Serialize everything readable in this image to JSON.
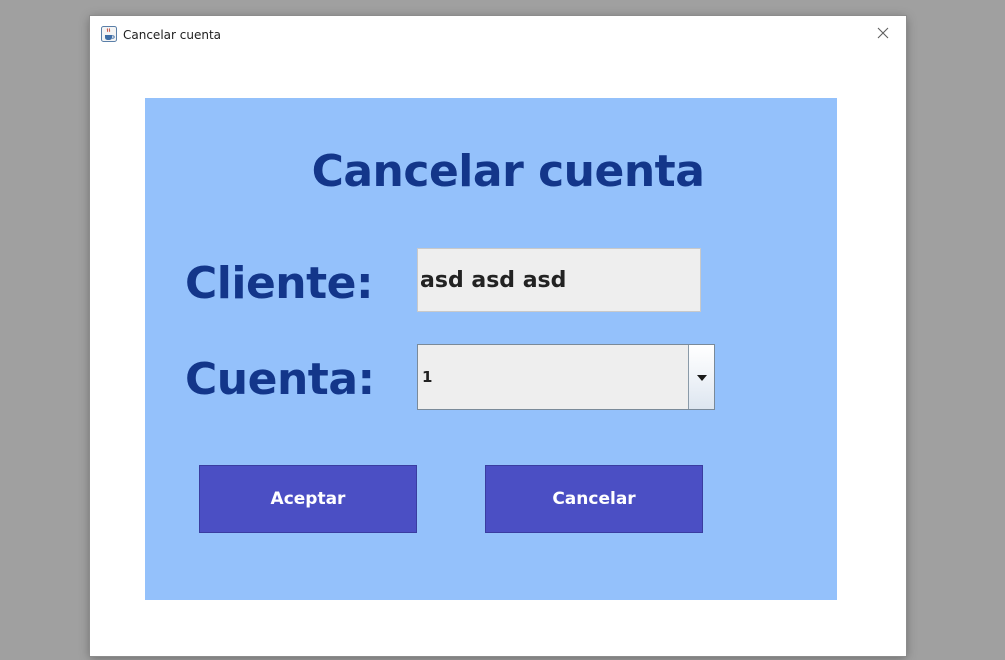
{
  "window": {
    "title": "Cancelar cuenta",
    "icon": "java-coffee-icon",
    "close_icon": "close-icon"
  },
  "form": {
    "heading": "Cancelar cuenta",
    "cliente_label": "Cliente:",
    "cliente_value": "asd asd asd",
    "cuenta_label": "Cuenta:",
    "cuenta_selected": "1",
    "cuenta_arrow_icon": "chevron-down-icon"
  },
  "buttons": {
    "accept_label": "Aceptar",
    "cancel_label": "Cancelar"
  },
  "colors": {
    "panel_background": "#94c1fb",
    "heading_text": "#13368a",
    "button_background": "#4b4fc4",
    "button_text": "#ffffff",
    "field_background": "#eeeeee"
  }
}
